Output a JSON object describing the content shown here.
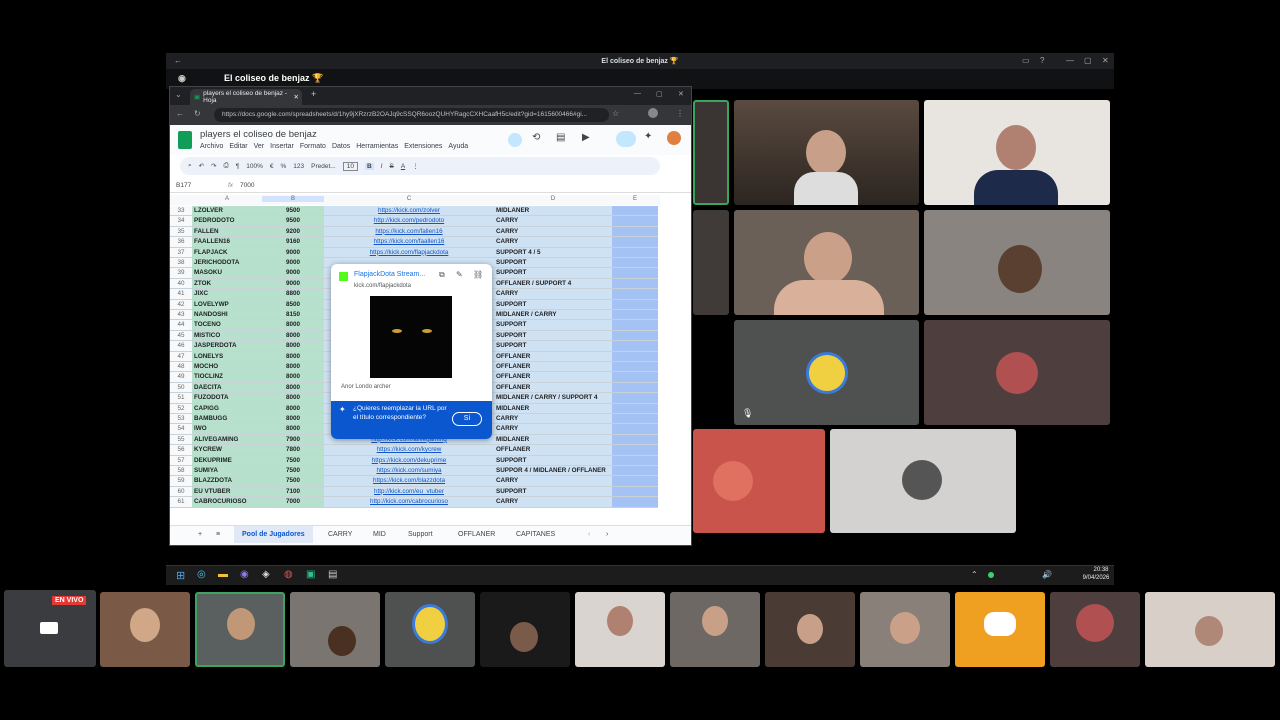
{
  "discord": {
    "window_title": "El coliseo de benjaz 🏆",
    "server_title": "El coliseo de benjaz 🏆"
  },
  "browser": {
    "tab_title": "players el coliseo de benjaz - Hoja",
    "url": "https://docs.google.com/spreadsheets/d/1hy9jXRzrzB2OAJq9cSSQR6oozQUHYRagcCXHCaafH5c/edit?gid=1615600466#gi..."
  },
  "sheet": {
    "title": "players el coliseo de benjaz",
    "menus": [
      "Archivo",
      "Editar",
      "Ver",
      "Insertar",
      "Formato",
      "Datos",
      "Herramientas",
      "Extensiones",
      "Ayuda"
    ],
    "toolbar": {
      "zoom": "100%",
      "font": "Predet...",
      "size": "10",
      "num": "123"
    },
    "cell_ref": "B177",
    "formula": "7000",
    "columns": [
      "A",
      "B",
      "C",
      "D",
      "E"
    ],
    "rows": [
      {
        "n": "33",
        "name": "LZOLVER",
        "pts": "9500",
        "link": "https://kick.com/zolver",
        "role": "MIDLANER"
      },
      {
        "n": "34",
        "name": "PEDRODOTO",
        "pts": "9500",
        "link": "http://kick.com/pedrodoto",
        "role": "CARRY"
      },
      {
        "n": "35",
        "name": "FALLEN",
        "pts": "9200",
        "link": "https://kick.com/fallen16",
        "role": "CARRY"
      },
      {
        "n": "36",
        "name": "FAALLEN16",
        "pts": "9160",
        "link": "https://kick.com/faallen16",
        "role": "CARRY"
      },
      {
        "n": "37",
        "name": "FLAPJACK",
        "pts": "9000",
        "link": "https://kick.com/flapjackdota",
        "role": "SUPPORT 4 / 5"
      },
      {
        "n": "38",
        "name": "JERICHODOTA",
        "pts": "9000",
        "link": "",
        "role": "SUPPORT"
      },
      {
        "n": "39",
        "name": "MASOKU",
        "pts": "9000",
        "link": "",
        "role": "SUPPORT"
      },
      {
        "n": "40",
        "name": "ZTOK",
        "pts": "9000",
        "link": "",
        "role": "OFFLANER / SUPPORT 4"
      },
      {
        "n": "41",
        "name": "JIXC",
        "pts": "8800",
        "link": "",
        "role": "CARRY"
      },
      {
        "n": "42",
        "name": "LOVELYWP",
        "pts": "8500",
        "link": "",
        "role": "SUPPORT"
      },
      {
        "n": "43",
        "name": "NANDOSHI",
        "pts": "8150",
        "link": "",
        "role": "MIDLANER / CARRY"
      },
      {
        "n": "44",
        "name": "TOCENO",
        "pts": "8000",
        "link": "",
        "role": "SUPPORT"
      },
      {
        "n": "45",
        "name": "MISTICO",
        "pts": "8000",
        "link": "",
        "role": "SUPPORT"
      },
      {
        "n": "46",
        "name": "JASPERDOTA",
        "pts": "8000",
        "link": "",
        "role": "SUPPORT"
      },
      {
        "n": "47",
        "name": "LONELYS",
        "pts": "8000",
        "link": "",
        "role": "OFFLANER"
      },
      {
        "n": "48",
        "name": "MOCHO",
        "pts": "8000",
        "link": "",
        "role": "OFFLANER"
      },
      {
        "n": "49",
        "name": "TIOCLINZ",
        "pts": "8000",
        "link": "",
        "role": "OFFLANER"
      },
      {
        "n": "50",
        "name": "DAECITA",
        "pts": "8000",
        "link": "",
        "role": "OFFLANER"
      },
      {
        "n": "51",
        "name": "FUZODOTA",
        "pts": "8000",
        "link": "",
        "role": "MIDLANER / CARRY / SUPPORT 4"
      },
      {
        "n": "52",
        "name": "CAPIGG",
        "pts": "8000",
        "link": "",
        "role": "MIDLANER"
      },
      {
        "n": "53",
        "name": "BAMBUGG",
        "pts": "8000",
        "link": "",
        "role": "CARRY"
      },
      {
        "n": "54",
        "name": "IWO",
        "pts": "8000",
        "link": "",
        "role": "CARRY"
      },
      {
        "n": "55",
        "name": "ALIVEGAMING",
        "pts": "7900",
        "link": "http://kick.com/alivegaming",
        "role": "MIDLANER"
      },
      {
        "n": "56",
        "name": "KYCREW",
        "pts": "7800",
        "link": "https://kick.com/kycrew",
        "role": "OFFLANER"
      },
      {
        "n": "57",
        "name": "DEKUPRIME",
        "pts": "7500",
        "link": "https://kick.com/dekuprime",
        "role": "SUPPORT"
      },
      {
        "n": "58",
        "name": "SUMIYA",
        "pts": "7500",
        "link": "https://kick.com/sumiya",
        "role": "SUPPOR 4 / MIDLANER / OFFLANER"
      },
      {
        "n": "59",
        "name": "BLAZZDOTA",
        "pts": "7500",
        "link": "https://kick.com/blazzdota",
        "role": "CARRY"
      },
      {
        "n": "60",
        "name": "EU VTUBER",
        "pts": "7100",
        "link": "http://kick.com/eu_vtuber",
        "role": "SUPPORT"
      },
      {
        "n": "61",
        "name": "CABROCURIOSO",
        "pts": "7000",
        "link": "http://kick.com/cabrocurioso",
        "role": "CARRY"
      }
    ],
    "tabs": [
      "Pool de Jugadores",
      "CARRY",
      "MID",
      "Support",
      "OFFLANER",
      "CAPITANES"
    ]
  },
  "popup": {
    "title": "FlapjackDota Stream...",
    "domain": "kick.com/flapjackdota",
    "caption": "Anor Londo archer",
    "prompt": "¿Quieres reemplazar la URL por el título correspondiente?",
    "yes": "Sí"
  },
  "taskbar": {
    "time": "20:38",
    "date": "9/04/2026"
  },
  "stream": {
    "live_badge": "EN VIVO"
  },
  "colors": {
    "discord_bg": "#111214",
    "sheet_green": "#b7e1cd",
    "sheet_blue": "#cfe2f3",
    "live_red": "#e53935",
    "discord_blurple": "#f0a020"
  }
}
